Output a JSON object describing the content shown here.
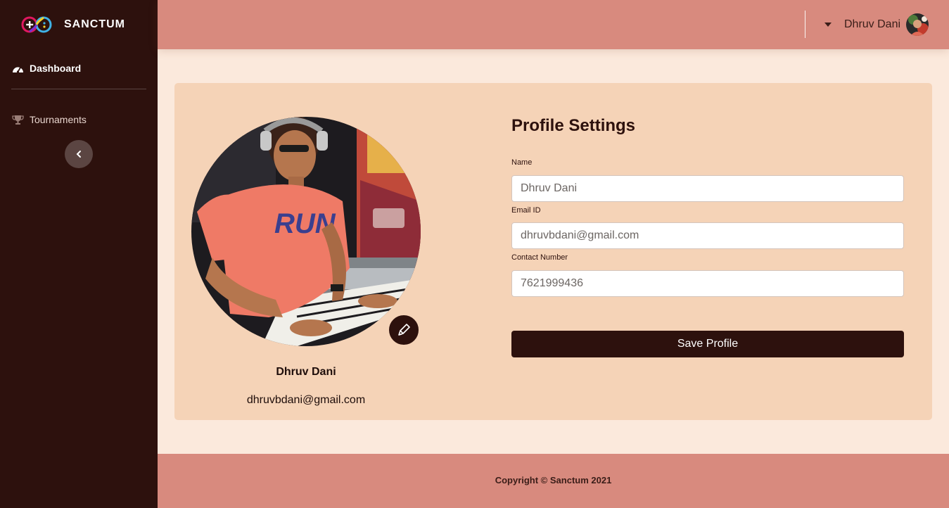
{
  "sidebar": {
    "brand": "SANCTUM",
    "items": [
      {
        "label": "Dashboard",
        "icon": "tachometer-icon"
      },
      {
        "label": "Tournaments",
        "icon": "trophy-icon"
      }
    ],
    "collapse_icon": "chevron-left-icon"
  },
  "topbar": {
    "user_name": "Dhruv Dani"
  },
  "profile": {
    "name": "Dhruv Dani",
    "email": "dhruvbdani@gmail.com",
    "edit_icon": "pencil-icon"
  },
  "form": {
    "title": "Profile Settings",
    "fields": [
      {
        "label": "Name",
        "value": "Dhruv Dani"
      },
      {
        "label": "Email ID",
        "value": "dhruvbdani@gmail.com"
      },
      {
        "label": "Contact Number",
        "value": "7621999436"
      }
    ],
    "save_label": "Save Profile"
  },
  "footer": {
    "text": "Copyright © Sanctum 2021"
  },
  "colors": {
    "sidebar": "#2d110d",
    "topbar": "#d88a7e",
    "card": "#f5d3b7",
    "page_bg": "#fbe9dc",
    "button": "#2d110d"
  }
}
